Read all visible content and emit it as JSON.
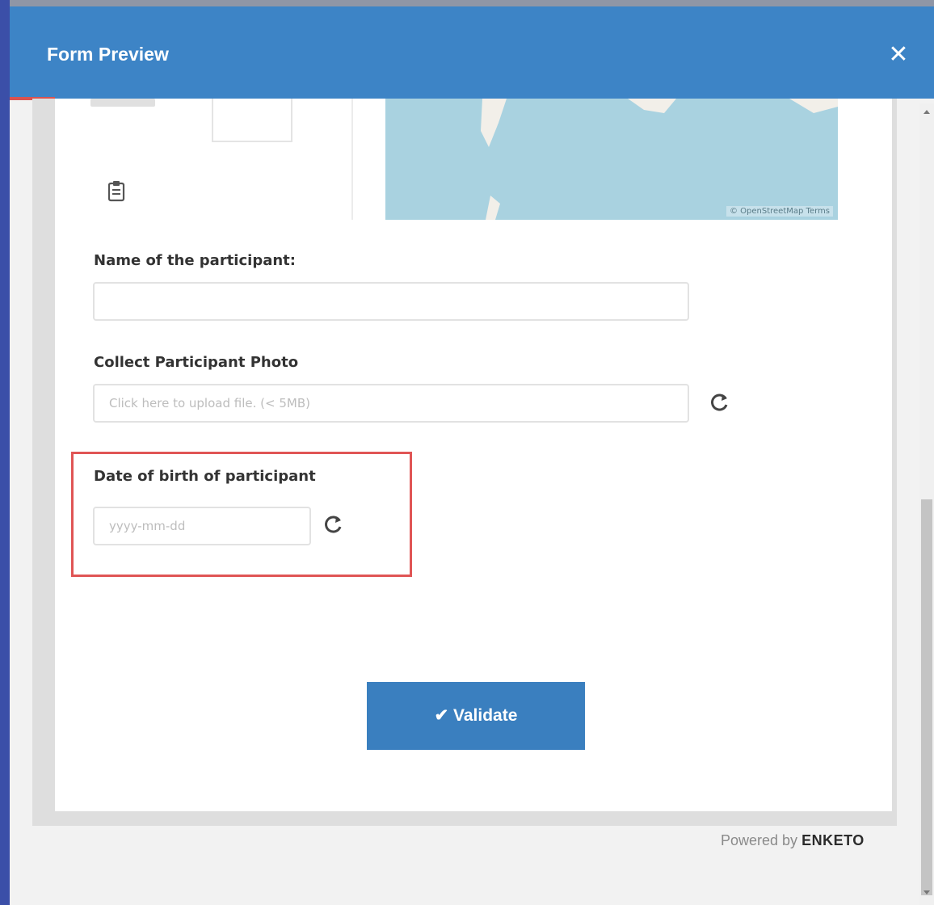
{
  "modal": {
    "title": "Form Preview",
    "close_glyph": "✕"
  },
  "map": {
    "attribution": "© OpenStreetMap  Terms"
  },
  "form": {
    "name_label": "Name of the participant:",
    "name_value": "",
    "photo_label": "Collect Participant Photo",
    "photo_placeholder": "Click here to upload file. (< 5MB)",
    "dob_label": "Date of birth of participant",
    "dob_placeholder": "yyyy-mm-dd",
    "validate_label": "✔ Validate"
  },
  "footer": {
    "powered_prefix": "Powered by ",
    "powered_brand": "ENKETO"
  },
  "icons": {
    "clipboard": "clipboard-icon",
    "refresh": "refresh-icon",
    "close": "close-icon",
    "check": "check-icon"
  },
  "colors": {
    "header": "#3d84c6",
    "button": "#3a7fbf",
    "highlight": "#e05555",
    "background": "#3b4fa8"
  }
}
